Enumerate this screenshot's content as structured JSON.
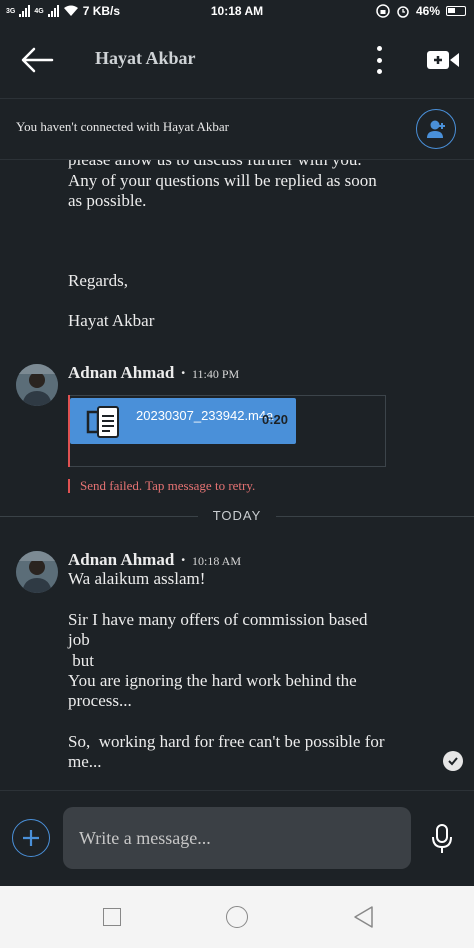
{
  "status_bar": {
    "network_left": "3G",
    "network_right": "4G",
    "speed": "7 KB/s",
    "time": "10:18 AM",
    "battery": "46%"
  },
  "header": {
    "title": "Hayat Akbar"
  },
  "banner": {
    "text": "You haven't connected with Hayat Akbar"
  },
  "messages": {
    "intro_lines": [
      "please allow us to discuss further with you.",
      "Any of your questions will be replied as soon",
      "as possible.",
      "Regards,",
      "Hayat Akbar"
    ],
    "attachment_msg": {
      "sender": "Adnan Ahmad",
      "time": "11:40 PM",
      "file_name": "20230307_233942.m4a",
      "duration": "0:20",
      "error": "Send failed. Tap message to retry."
    },
    "divider": "TODAY",
    "reply_msg": {
      "sender": "Adnan Ahmad",
      "time": "10:18 AM",
      "lines": [
        "Wa alaikum asslam!",
        "Sir I have many offers of commission based",
        "job",
        " but",
        "You are ignoring the hard work behind the",
        "process...",
        "So,  working hard for free can't be possible for",
        "me..."
      ]
    }
  },
  "composer": {
    "placeholder": "Write a message..."
  },
  "colors": {
    "background": "#1d2226",
    "accent": "#4a90d9",
    "error": "#e57373"
  }
}
